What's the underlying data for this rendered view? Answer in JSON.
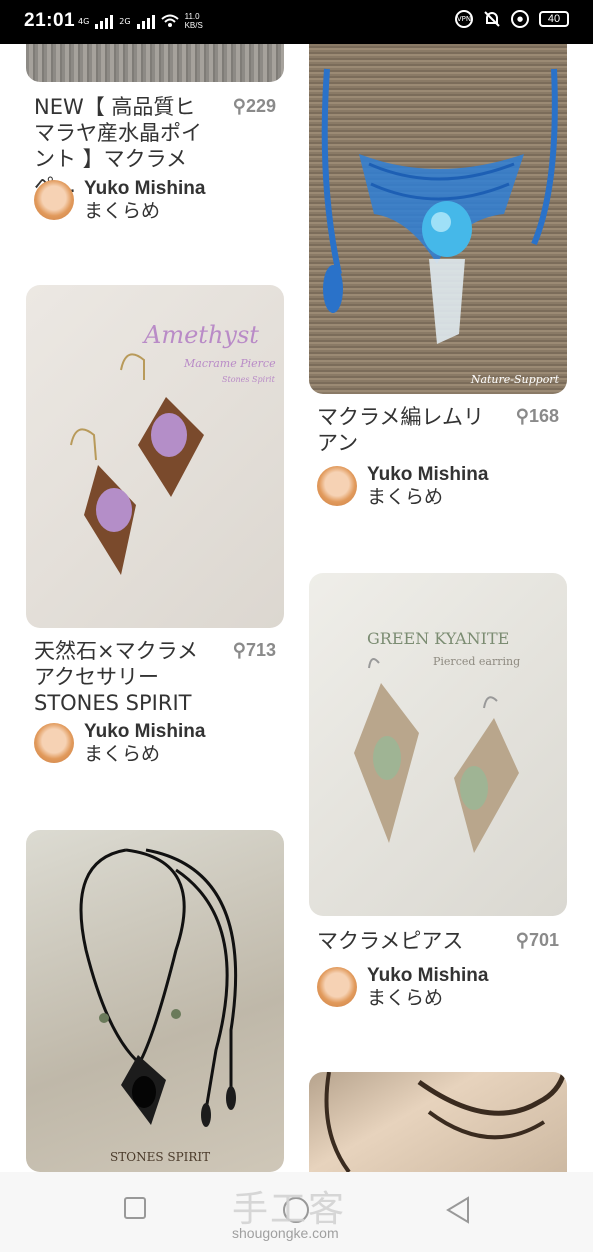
{
  "status_bar": {
    "time": "21:01",
    "net1": "4G",
    "net2": "2G",
    "speed_value": "11.0",
    "speed_unit": "KB/S",
    "vpn": "VPN",
    "battery": "40"
  },
  "pins": [
    {
      "id": "p1",
      "title": "NEW【 高品質ヒマラヤ産水晶ポイント 】マクラメペ…",
      "saves": "229",
      "author": "Yuko Mishina",
      "author_sub": "まくらめ"
    },
    {
      "id": "p2",
      "title": "マクラメ編レムリアン",
      "saves": "168",
      "author": "Yuko Mishina",
      "author_sub": "まくらめ",
      "image_caption": "Nature-Support"
    },
    {
      "id": "p3",
      "title": "天然石×マクラメアクセサリー STONES SPIRIT",
      "saves": "713",
      "author": "Yuko Mishina",
      "author_sub": "まくらめ",
      "image_text": {
        "title": "Amethyst",
        "sub": "Macrame Pierce",
        "sub2": "Stones Spirit"
      }
    },
    {
      "id": "p4",
      "title": "マクラメピアス",
      "saves": "701",
      "author": "Yuko Mishina",
      "author_sub": "まくらめ",
      "image_text": {
        "title": "GREEN KYANITE",
        "sub": "Pierced earring"
      }
    },
    {
      "id": "p5",
      "image_text": {
        "title": "STONES SPIRIT"
      }
    }
  ],
  "watermark": {
    "cn": "手工客",
    "url": "shougongke.com"
  },
  "colors": {
    "card_bg": "#e9e6e1",
    "blue": "#2a72c9",
    "brown": "#6b4327",
    "text": "#333333",
    "muted": "#8a8a8a"
  }
}
